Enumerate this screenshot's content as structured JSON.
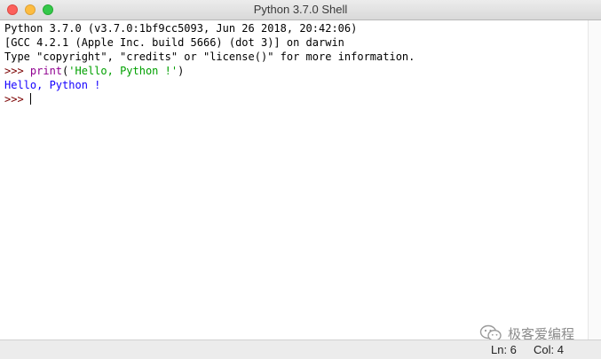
{
  "window": {
    "title": "Python 3.7.0 Shell"
  },
  "shell": {
    "banner_line1": "Python 3.7.0 (v3.7.0:1bf9cc5093, Jun 26 2018, 20:42:06)",
    "banner_line2": "[GCC 4.2.1 (Apple Inc. build 5666) (dot 3)] on darwin",
    "banner_line3": "Type \"copyright\", \"credits\" or \"license()\" for more information.",
    "prompt": ">>> ",
    "command_func": "print",
    "command_open": "(",
    "command_string": "'Hello, Python !'",
    "command_close": ")",
    "output": "Hello, Python !",
    "current_prompt": ">>> "
  },
  "status": {
    "line": "Ln: 6",
    "column": "Col: 4"
  },
  "watermark": {
    "text": "极客爱编程"
  },
  "colors": {
    "prompt": "#7a0000",
    "builtin": "#900090",
    "string": "#00a000",
    "output": "#1400ff"
  }
}
